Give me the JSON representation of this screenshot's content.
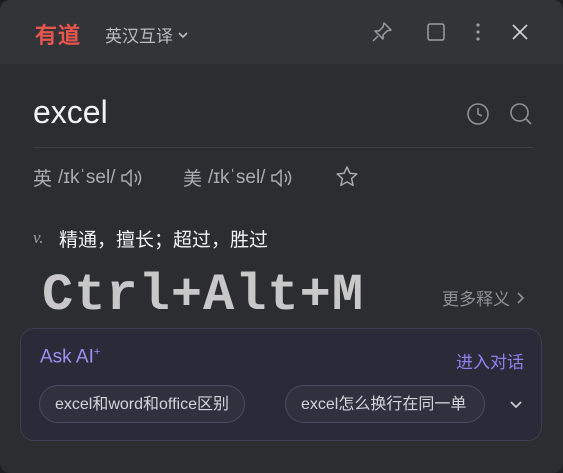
{
  "app": {
    "logo": "有道",
    "mode_label": "英汉互译"
  },
  "query": {
    "word": "excel"
  },
  "phonetics": [
    {
      "lang": "英",
      "ipa": "/ɪkˈsel/"
    },
    {
      "lang": "美",
      "ipa": "/ɪkˈsel/"
    }
  ],
  "definition": {
    "pos": "v.",
    "meaning": "精通，擅长；超过，胜过"
  },
  "overlay": {
    "shortcut": "Ctrl+Alt+M"
  },
  "more_label": "更多释义",
  "ask_ai": {
    "title": "Ask AI",
    "sup": "+",
    "link": "进入对话",
    "suggestions": [
      "excel和word和office区别",
      "excel怎么换行在同一单"
    ]
  },
  "colors": {
    "brand": "#e8554e",
    "accent": "#9f8ff5",
    "background": "#2b2d30"
  },
  "icons": [
    "pin-icon",
    "square-icon",
    "more-vertical-icon",
    "close-icon",
    "history-icon",
    "search-icon",
    "speaker-icon",
    "star-icon",
    "chevron-down-icon",
    "chevron-right-icon"
  ]
}
